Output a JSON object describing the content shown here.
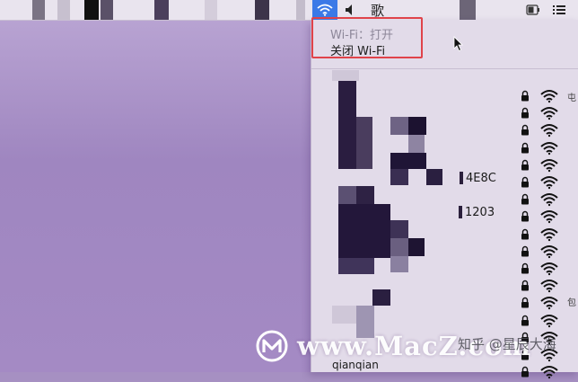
{
  "menubar": {
    "ime_label": "歌",
    "wifi_active_color": "#3b79e7",
    "icons": [
      "wifi-icon",
      "speaker-icon",
      "battery-icon",
      "list-icon"
    ]
  },
  "wifi_menu": {
    "status_label": "Wi-Fi：打开",
    "turn_off_label": "关闭 Wi-Fi",
    "networks": [
      {
        "ssid": "4E8C",
        "locked": true
      },
      {
        "ssid": "1203",
        "locked": true
      },
      {
        "ssid": "qianqian",
        "locked": true
      }
    ]
  },
  "overlay": {
    "watermark_url": "www.MacZ.com",
    "credit": "知乎 @星辰大海",
    "edge_chars": [
      "屯",
      "包"
    ]
  },
  "colors": {
    "highlight_border": "#e0434a",
    "desktop": "#a690c2",
    "menu_bg": "#e2dbe9"
  }
}
